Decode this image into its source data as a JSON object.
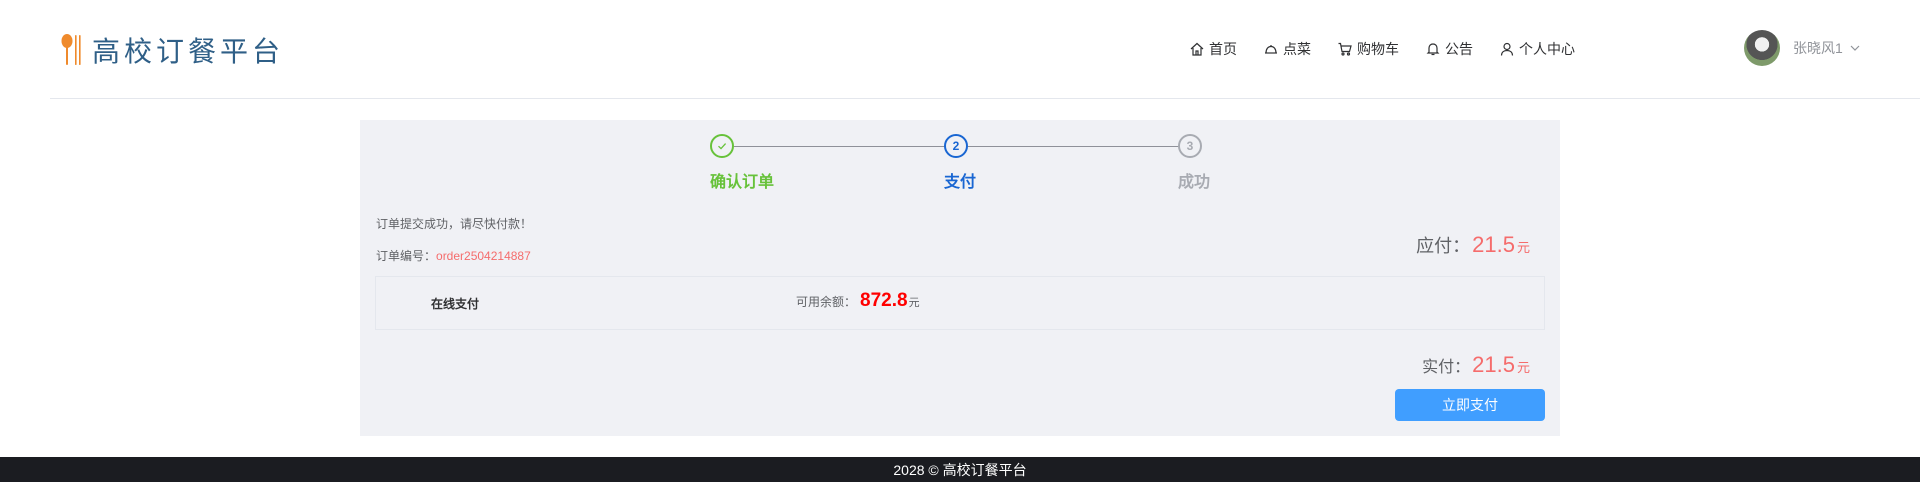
{
  "app": {
    "title": "高校订餐平台",
    "accent": "#409eff",
    "danger": "#f56c6c"
  },
  "nav": {
    "items": [
      {
        "label": "首页",
        "icon": "home-icon"
      },
      {
        "label": "点菜",
        "icon": "dish-cover-icon"
      },
      {
        "label": "购物车",
        "icon": "cart-icon"
      },
      {
        "label": "公告",
        "icon": "bell-icon"
      },
      {
        "label": "个人中心",
        "icon": "user-icon"
      }
    ]
  },
  "user": {
    "name": "张晓风1",
    "avatar_icon": "avatar"
  },
  "steps": {
    "items": [
      {
        "label": "确认订单",
        "state": "done",
        "color": "#67c23a",
        "icon": "check-icon"
      },
      {
        "label": "支付",
        "number": "2",
        "state": "active",
        "color": "#1966d2"
      },
      {
        "label": "成功",
        "number": "3",
        "state": "pending",
        "color": "#a8abb2"
      }
    ]
  },
  "order": {
    "message": "订单提交成功，请尽快付款！",
    "number_label": "订单编号：",
    "number": "order2504214887",
    "payable_label": "应付：",
    "payable_amount": "21.5",
    "unit": "元",
    "payment_method": "在线支付",
    "balance_label": "可用余额：",
    "balance_amount": "872.8",
    "actual_label": "实付：",
    "actual_amount": "21.5",
    "pay_button": "立即支付"
  },
  "footer": {
    "text": "2028 © 高校订餐平台"
  }
}
